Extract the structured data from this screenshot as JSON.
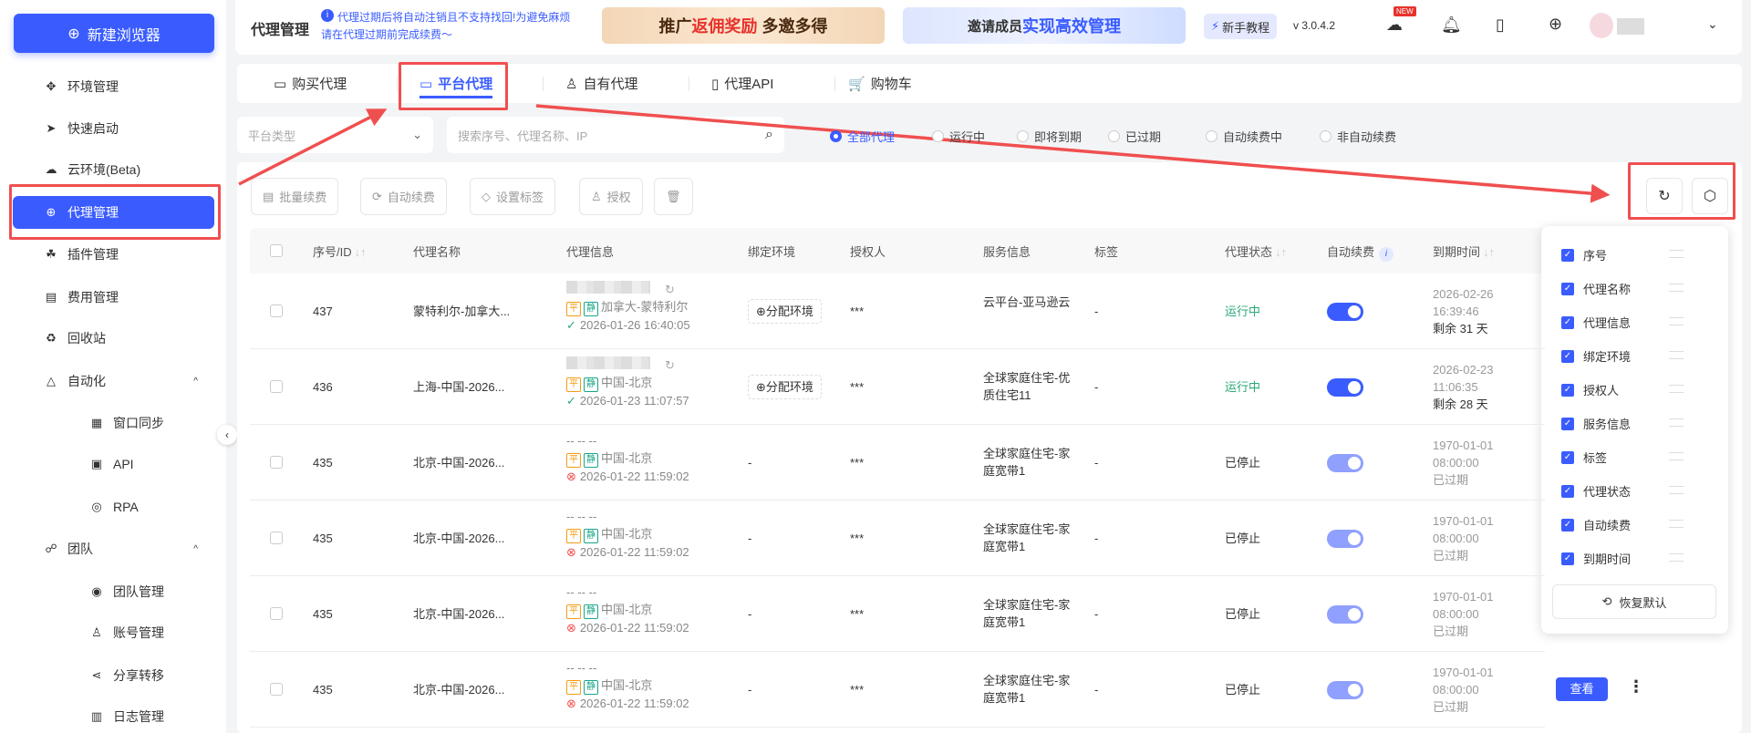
{
  "sidebar": {
    "new_browser": "新建浏览器",
    "items": [
      {
        "label": "环境管理",
        "icon": "✥"
      },
      {
        "label": "快速启动",
        "icon": "➤"
      },
      {
        "label": "云环境(Beta)",
        "icon": "☁"
      },
      {
        "label": "代理管理",
        "icon": "⊕",
        "active": true
      },
      {
        "label": "插件管理",
        "icon": "☘"
      },
      {
        "label": "费用管理",
        "icon": "▤"
      },
      {
        "label": "回收站",
        "icon": "♻"
      },
      {
        "label": "自动化",
        "icon": "△",
        "expand": "^"
      },
      {
        "label": "窗口同步",
        "icon": "▦",
        "sub": true
      },
      {
        "label": "API",
        "icon": "▣",
        "sub": true
      },
      {
        "label": "RPA",
        "icon": "◎",
        "sub": true
      },
      {
        "label": "团队",
        "icon": "☍",
        "expand": "^"
      },
      {
        "label": "团队管理",
        "icon": "◉",
        "sub": true
      },
      {
        "label": "账号管理",
        "icon": "♙",
        "sub": true
      },
      {
        "label": "分享转移",
        "icon": "⋖",
        "sub": true
      },
      {
        "label": "日志管理",
        "icon": "▥",
        "sub": true
      }
    ]
  },
  "header": {
    "title": "代理管理",
    "notice": "代理过期后将自动注销且不支持找回!为避免麻烦请在代理过期前完成续费～",
    "banner1_a": "推广",
    "banner1_b": "返佣奖励",
    "banner1_c": "多邀多得",
    "banner2_a": "邀请成员",
    "banner2_b": "实现高效管理",
    "tutorial": "新手教程",
    "version": "v 3.0.4.2",
    "new_badge": "NEW"
  },
  "tabs": [
    {
      "label": "购买代理",
      "icon": "▭"
    },
    {
      "label": "平台代理",
      "icon": "▭",
      "active": true
    },
    {
      "label": "自有代理",
      "icon": "♙"
    },
    {
      "label": "代理API",
      "icon": "▯"
    },
    {
      "label": "购物车",
      "icon": "🛒"
    }
  ],
  "filters": {
    "platform_placeholder": "平台类型",
    "search_placeholder": "搜索序号、代理名称、IP",
    "radios": [
      "全部代理",
      "运行中",
      "即将到期",
      "已过期",
      "自动续费中",
      "非自动续费"
    ],
    "selected": "全部代理"
  },
  "toolbar": {
    "batch_renew": "批量续费",
    "auto_renew": "自动续费",
    "set_tag": "设置标签",
    "authorize": "授权"
  },
  "table": {
    "headers": [
      "序号/ID",
      "代理名称",
      "代理信息",
      "绑定环境",
      "授权人",
      "服务信息",
      "标签",
      "代理状态",
      "自动续费",
      "到期时间"
    ],
    "rows": [
      {
        "id": "437",
        "name": "蒙特利尔-加拿大...",
        "ip": "",
        "location": "加拿大-蒙特利尔",
        "created": "2026-01-26 16:40:05",
        "created_ok": true,
        "bind": "⊕分配环境",
        "auth": "***",
        "service": "云平台-亚马逊云",
        "tag": "-",
        "status": "运行中",
        "auto": true,
        "expiry_date": "2026-02-26",
        "expiry_time": "16:39:46",
        "remaining": "剩余 31 天"
      },
      {
        "id": "436",
        "name": "上海-中国-2026...",
        "ip": "",
        "location": "中国-北京",
        "created": "2026-01-23 11:07:57",
        "created_ok": true,
        "bind": "⊕分配环境",
        "auth": "***",
        "service": "全球家庭住宅-优质住宅11",
        "tag": "-",
        "status": "运行中",
        "auto": true,
        "expiry_date": "2026-02-23",
        "expiry_time": "11:06:35",
        "remaining": "剩余 28 天"
      },
      {
        "id": "435",
        "name": "北京-中国-2026...",
        "ip": "-- -- --",
        "location": "中国-北京",
        "created": "2026-01-22 11:59:02",
        "created_ok": false,
        "bind": "-",
        "auth": "***",
        "service": "全球家庭住宅-家庭宽带1",
        "tag": "-",
        "status": "已停止",
        "auto": false,
        "expiry_date": "1970-01-01",
        "expiry_time": "08:00:00",
        "remaining": "已过期"
      },
      {
        "id": "435",
        "name": "北京-中国-2026...",
        "ip": "-- -- --",
        "location": "中国-北京",
        "created": "2026-01-22 11:59:02",
        "created_ok": false,
        "bind": "-",
        "auth": "***",
        "service": "全球家庭住宅-家庭宽带1",
        "tag": "-",
        "status": "已停止",
        "auto": false,
        "expiry_date": "1970-01-01",
        "expiry_time": "08:00:00",
        "remaining": "已过期"
      },
      {
        "id": "435",
        "name": "北京-中国-2026...",
        "ip": "-- -- --",
        "location": "中国-北京",
        "created": "2026-01-22 11:59:02",
        "created_ok": false,
        "bind": "-",
        "auth": "***",
        "service": "全球家庭住宅-家庭宽带1",
        "tag": "-",
        "status": "已停止",
        "auto": false,
        "expiry_date": "1970-01-01",
        "expiry_time": "08:00:00",
        "remaining": "已过期"
      },
      {
        "id": "435",
        "name": "北京-中国-2026...",
        "ip": "-- -- --",
        "location": "中国-北京",
        "created": "2026-01-22 11:59:02",
        "created_ok": false,
        "bind": "-",
        "auth": "***",
        "service": "全球家庭住宅-家庭宽带1",
        "tag": "-",
        "status": "已停止",
        "auto": false,
        "expiry_date": "1970-01-01",
        "expiry_time": "08:00:00",
        "remaining": "已过期",
        "view": "查看"
      }
    ],
    "tag_ping": "平",
    "tag_jing": "静"
  },
  "column_panel": {
    "items": [
      "序号",
      "代理名称",
      "代理信息",
      "绑定环境",
      "授权人",
      "服务信息",
      "标签",
      "代理状态",
      "自动续费",
      "到期时间"
    ],
    "reset": "恢复默认"
  },
  "colors": {
    "accent": "#3a5cff",
    "running": "#2aa876",
    "annotation": "#f04f4f"
  }
}
